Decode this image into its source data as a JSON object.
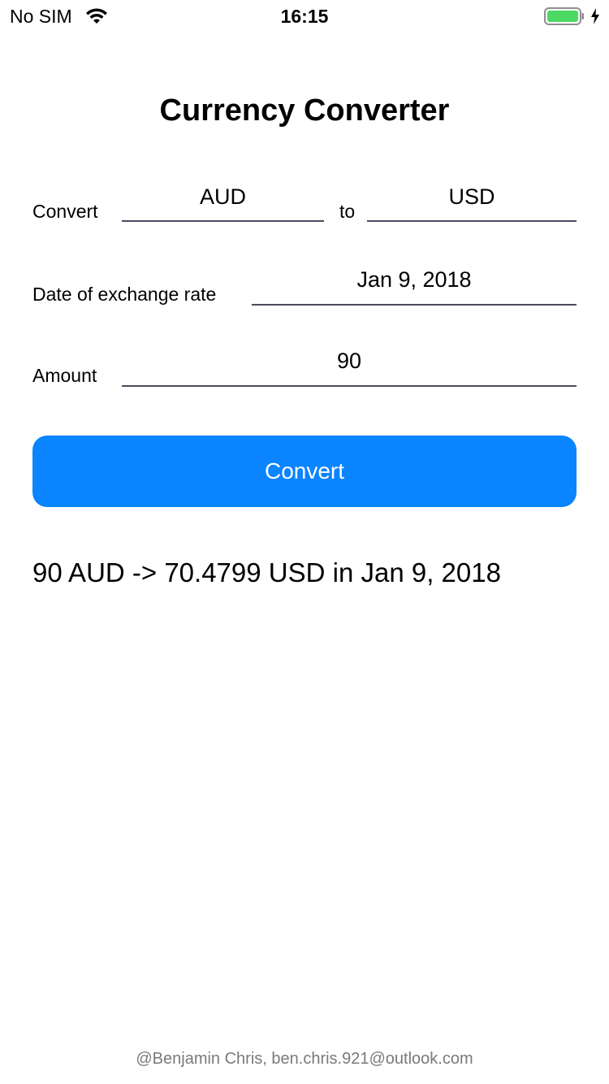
{
  "status_bar": {
    "carrier": "No SIM",
    "time": "16:15",
    "wifi_icon": "wifi-icon",
    "battery_icon": "battery-charging-icon",
    "battery_color": "#4cd964"
  },
  "header": {
    "title": "Currency Converter"
  },
  "form": {
    "convert_label": "Convert",
    "from_currency": "AUD",
    "to_label": "to",
    "to_currency": "USD",
    "date_label": "Date of exchange rate",
    "date_value": "Jan 9, 2018",
    "amount_label": "Amount",
    "amount_value": "90",
    "button_label": "Convert",
    "button_color": "#0a84ff"
  },
  "result": {
    "text": "90 AUD -> 70.4799 USD in Jan 9, 2018"
  },
  "footer": {
    "credit": "@Benjamin Chris, ben.chris.921@outlook.com"
  }
}
